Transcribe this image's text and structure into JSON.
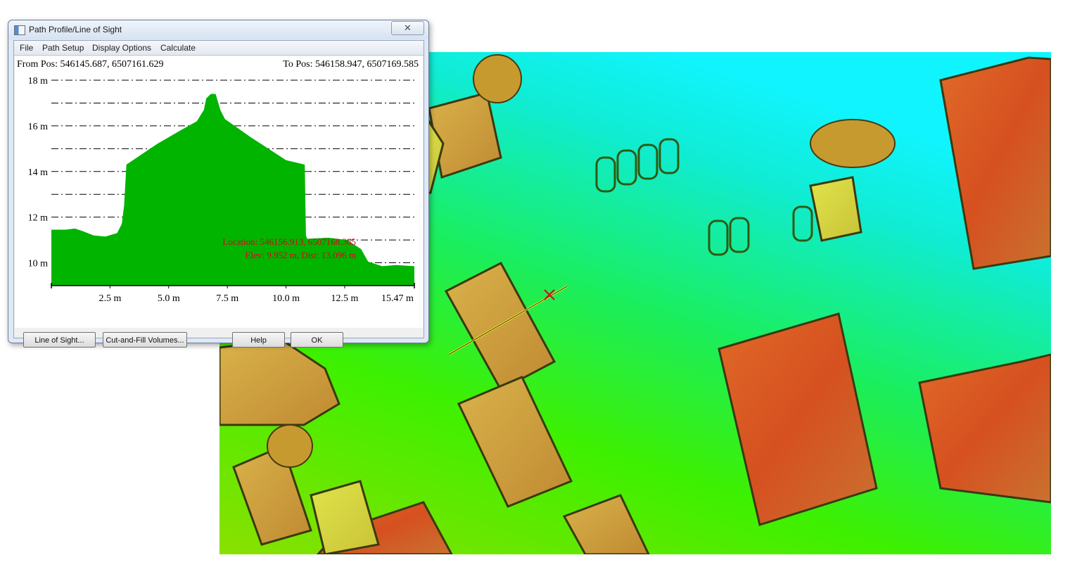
{
  "window": {
    "title": "Path Profile/Line of Sight",
    "close_glyph": "✕"
  },
  "menu": [
    "File",
    "Path Setup",
    "Display Options",
    "Calculate"
  ],
  "profile": {
    "from_pos": "From Pos: 546145.687, 6507161.629",
    "to_pos": "To Pos: 546158.947, 6507169.585",
    "location_label": "Location: 546156.913, 6507168.365",
    "elev_label": "Elev: 9.952 m, Dist: 13.096 m",
    "fill_color": "#00b400",
    "label_color": "#e0001c"
  },
  "chart_data": {
    "type": "area",
    "ylim": [
      9,
      18
    ],
    "xlim": [
      0,
      15.47
    ],
    "y_ticks": [
      "10 m",
      "12 m",
      "14 m",
      "16 m",
      "18 m"
    ],
    "y_tick_values": [
      10,
      12,
      14,
      16,
      18
    ],
    "x_ticks": [
      "2.5 m",
      "5.0 m",
      "7.5 m",
      "10.0 m",
      "12.5 m",
      "15.47 m"
    ],
    "x_tick_values": [
      2.5,
      5.0,
      7.5,
      10.0,
      12.5,
      15.47
    ],
    "gridlines_y": [
      10,
      11,
      12,
      13,
      14,
      15,
      16,
      17,
      18
    ],
    "series": [
      {
        "x": [
          0,
          0.6,
          1.0,
          1.3,
          1.8,
          2.3,
          2.8,
          3.0,
          3.1,
          3.2,
          4.5,
          5.5,
          6.2,
          6.5,
          6.6,
          6.8,
          7.0,
          7.2,
          7.4,
          8.5,
          10.0,
          10.8,
          10.85,
          10.9,
          11.8,
          12.6,
          13.2,
          13.5,
          14.1,
          14.7,
          15.47
        ],
        "y": [
          11.45,
          11.45,
          11.5,
          11.4,
          11.2,
          11.15,
          11.3,
          11.7,
          12.5,
          14.3,
          15.2,
          15.8,
          16.2,
          16.7,
          17.2,
          17.4,
          17.4,
          16.7,
          16.3,
          15.5,
          14.5,
          14.3,
          11.2,
          11.05,
          11.1,
          11.0,
          10.6,
          10.05,
          9.85,
          9.9,
          9.85
        ]
      }
    ]
  },
  "buttons": {
    "line_of_sight": "Line of Sight...",
    "cut_fill": "Cut-and-Fill Volumes...",
    "help": "Help",
    "ok": "OK"
  }
}
